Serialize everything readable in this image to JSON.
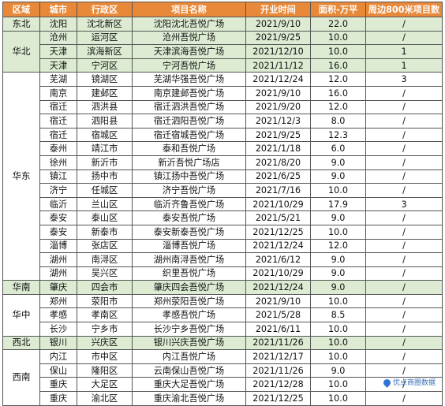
{
  "headers": [
    "区域",
    "城市",
    "行政区",
    "项目名称",
    "开业时间",
    "面积-万平",
    "周边800米项目数"
  ],
  "regions": [
    {
      "name": "东北",
      "rows": 1,
      "green": true
    },
    {
      "name": "华北",
      "rows": 3,
      "green": true
    },
    {
      "name": "华东",
      "rows": 15,
      "green": false
    },
    {
      "name": "华南",
      "rows": 1,
      "green": true
    },
    {
      "name": "华中",
      "rows": 3,
      "green": false
    },
    {
      "name": "西北",
      "rows": 1,
      "green": true
    },
    {
      "name": "西南",
      "rows": 4,
      "green": false
    }
  ],
  "rows": [
    [
      "沈阳",
      "沈北新区",
      "沈阳沈北吾悦广场",
      "2021/9/10",
      "22.0",
      "/"
    ],
    [
      "沧州",
      "运河区",
      "沧州吾悦广场",
      "2021/9/25",
      "10.0",
      "/"
    ],
    [
      "天津",
      "滨海新区",
      "天津滨海吾悦广场",
      "2021/12/10",
      "10.0",
      "1"
    ],
    [
      "天津",
      "宁河区",
      "宁河吾悦广场",
      "2021/11/12",
      "16.0",
      "1"
    ],
    [
      "芜湖",
      "镜湖区",
      "芜湖华强吾悦广场",
      "2021/12/24",
      "12.0",
      "3"
    ],
    [
      "南京",
      "建邺区",
      "南京建邺吾悦广场",
      "2021/9/10",
      "16.0",
      "/"
    ],
    [
      "宿迁",
      "泗洪县",
      "宿迁泗洪吾悦广场",
      "2021/9/20",
      "12.0",
      "/"
    ],
    [
      "宿迁",
      "泗阳县",
      "宿迁泗阳吾悦广场",
      "2021/12/3",
      "8.0",
      "/"
    ],
    [
      "宿迁",
      "宿城区",
      "宿迁宿城吾悦广场",
      "2021/9/25",
      "12.3",
      "/"
    ],
    [
      "泰州",
      "靖江市",
      "泰和吾悦广场",
      "2021/1/18",
      "6.0",
      "/"
    ],
    [
      "徐州",
      "新沂市",
      "新沂吾悦广场店",
      "2021/8/20",
      "9.0",
      "/"
    ],
    [
      "镇江",
      "扬中市",
      "镇江扬中吾悦广场",
      "2021/6/25",
      "9.0",
      "/"
    ],
    [
      "济宁",
      "任城区",
      "济宁吾悦广场",
      "2021/7/16",
      "10.0",
      "/"
    ],
    [
      "临沂",
      "兰山区",
      "临沂齐鲁吾悦广场",
      "2021/10/29",
      "17.9",
      "3"
    ],
    [
      "泰安",
      "泰山区",
      "泰安吾悦广场",
      "2021/5/21",
      "9.0",
      "/"
    ],
    [
      "泰安",
      "新泰市",
      "泰安新泰吾悦广场",
      "2021/12/25",
      "10.0",
      "/"
    ],
    [
      "淄博",
      "张店区",
      "淄博吾悦广场",
      "2021/12/24",
      "12.0",
      "/"
    ],
    [
      "湖州",
      "南浔区",
      "湖州南浔吾悦广场",
      "2021/6/12",
      "9.0",
      "/"
    ],
    [
      "湖州",
      "吴兴区",
      "织里吾悦广场",
      "2021/10/29",
      "9.0",
      "/"
    ],
    [
      "肇庆",
      "四会市",
      "肇庆四会吾悦广场",
      "2021/12/24",
      "9.0",
      "/"
    ],
    [
      "郑州",
      "荥阳市",
      "郑州荥阳吾悦广场",
      "2021/9/10",
      "10.0",
      "/"
    ],
    [
      "孝感",
      "孝南区",
      "孝感吾悦广场",
      "2021/5/28",
      "8.5",
      "/"
    ],
    [
      "长沙",
      "宁乡市",
      "长沙宁乡吾悦广场",
      "2021/6/11",
      "10.0",
      "/"
    ],
    [
      "银川",
      "兴庆区",
      "银川兴庆吾悦广场",
      "2021/11/26",
      "10.0",
      "/"
    ],
    [
      "内江",
      "市中区",
      "内江吾悦广场",
      "2021/12/17",
      "10.0",
      "/"
    ],
    [
      "保山",
      "隆阳区",
      "云南保山吾悦广场",
      "2021/11/26",
      "9.0",
      "/"
    ],
    [
      "重庆",
      "大足区",
      "重庆大足吾悦广场",
      "2021/12/28",
      "10.0",
      "/"
    ],
    [
      "重庆",
      "渝北区",
      "重庆渝北吾悦广场",
      "2021/12/25",
      "10.0",
      "/"
    ]
  ],
  "logo": {
    "text": "优点商圈数据",
    "icon": "map-pin-icon"
  },
  "watermark_text": "@优点商圈数据",
  "colors": {
    "header_bg": "#e8893a",
    "header_text": "#ffffff",
    "highlight_row": "#dcebd2",
    "border": "#555555"
  }
}
